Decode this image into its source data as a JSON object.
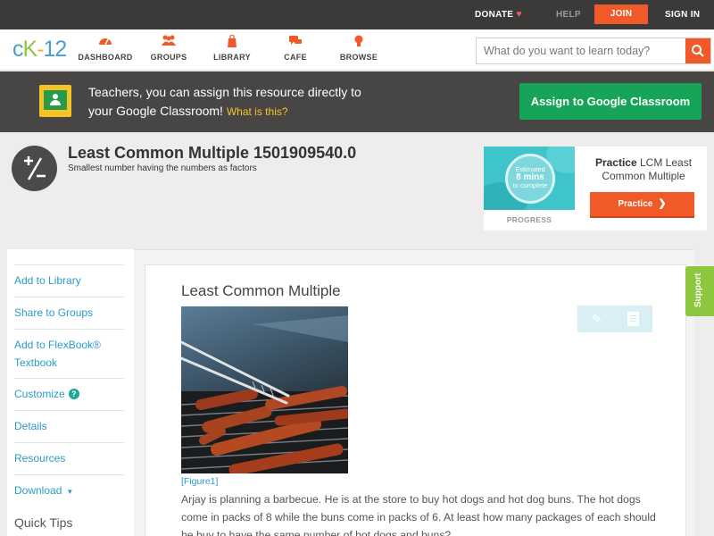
{
  "topbar": {
    "donate": "DONATE",
    "help": "HELP",
    "join": "JOIN",
    "signin": "SIGN IN"
  },
  "nav": {
    "logo": {
      "c": "c",
      "k": "K",
      "dash": "-",
      "num": "12"
    },
    "items": [
      {
        "label": "DASHBOARD",
        "icon": "dashboard-gauge-icon"
      },
      {
        "label": "GROUPS",
        "icon": "groups-people-icon"
      },
      {
        "label": "LIBRARY",
        "icon": "library-bag-icon"
      },
      {
        "label": "CAFE",
        "icon": "cafe-chat-icon"
      },
      {
        "label": "BROWSE",
        "icon": "browse-bulb-icon"
      }
    ],
    "search_placeholder": "What do you want to learn today?"
  },
  "banner": {
    "line1": "Teachers, you can assign this resource directly to",
    "line2": "your Google Classroom!",
    "what": "What is this?",
    "assign": "Assign to Google Classroom"
  },
  "header": {
    "title": "Least Common Multiple 1501909540.0",
    "subtitle": "Smallest number having the numbers as factors"
  },
  "practice": {
    "est_line1": "Estimated",
    "est_big": "8 mins",
    "est_line3": "to complete",
    "progress": "PROGRESS",
    "label_bold": "Practice",
    "label_rest": "LCM Least Common Multiple",
    "button": "Practice"
  },
  "sidebar": {
    "items": [
      {
        "label": "Add to Library"
      },
      {
        "label": "Share to Groups"
      },
      {
        "label": "Add to FlexBook® Textbook"
      },
      {
        "label": "Customize"
      },
      {
        "label": "Details"
      },
      {
        "label": "Resources"
      },
      {
        "label": "Download"
      }
    ],
    "tips": "Quick Tips"
  },
  "content": {
    "title": "Least Common Multiple",
    "figure_label": "[Figure1]",
    "paragraph": "Arjay is planning a barbecue. He is at the store to buy hot dogs and hot dog buns. The hot dogs come in packs of 8 while the buns come in packs of 6. At least how many packages of each should he buy to have the same number of hot dogs and buns?"
  },
  "support": "Support",
  "colors": {
    "accent": "#f05a28",
    "brand_green": "#8dc63f",
    "link": "#2c9bc9",
    "classroom_green": "#16a558"
  }
}
